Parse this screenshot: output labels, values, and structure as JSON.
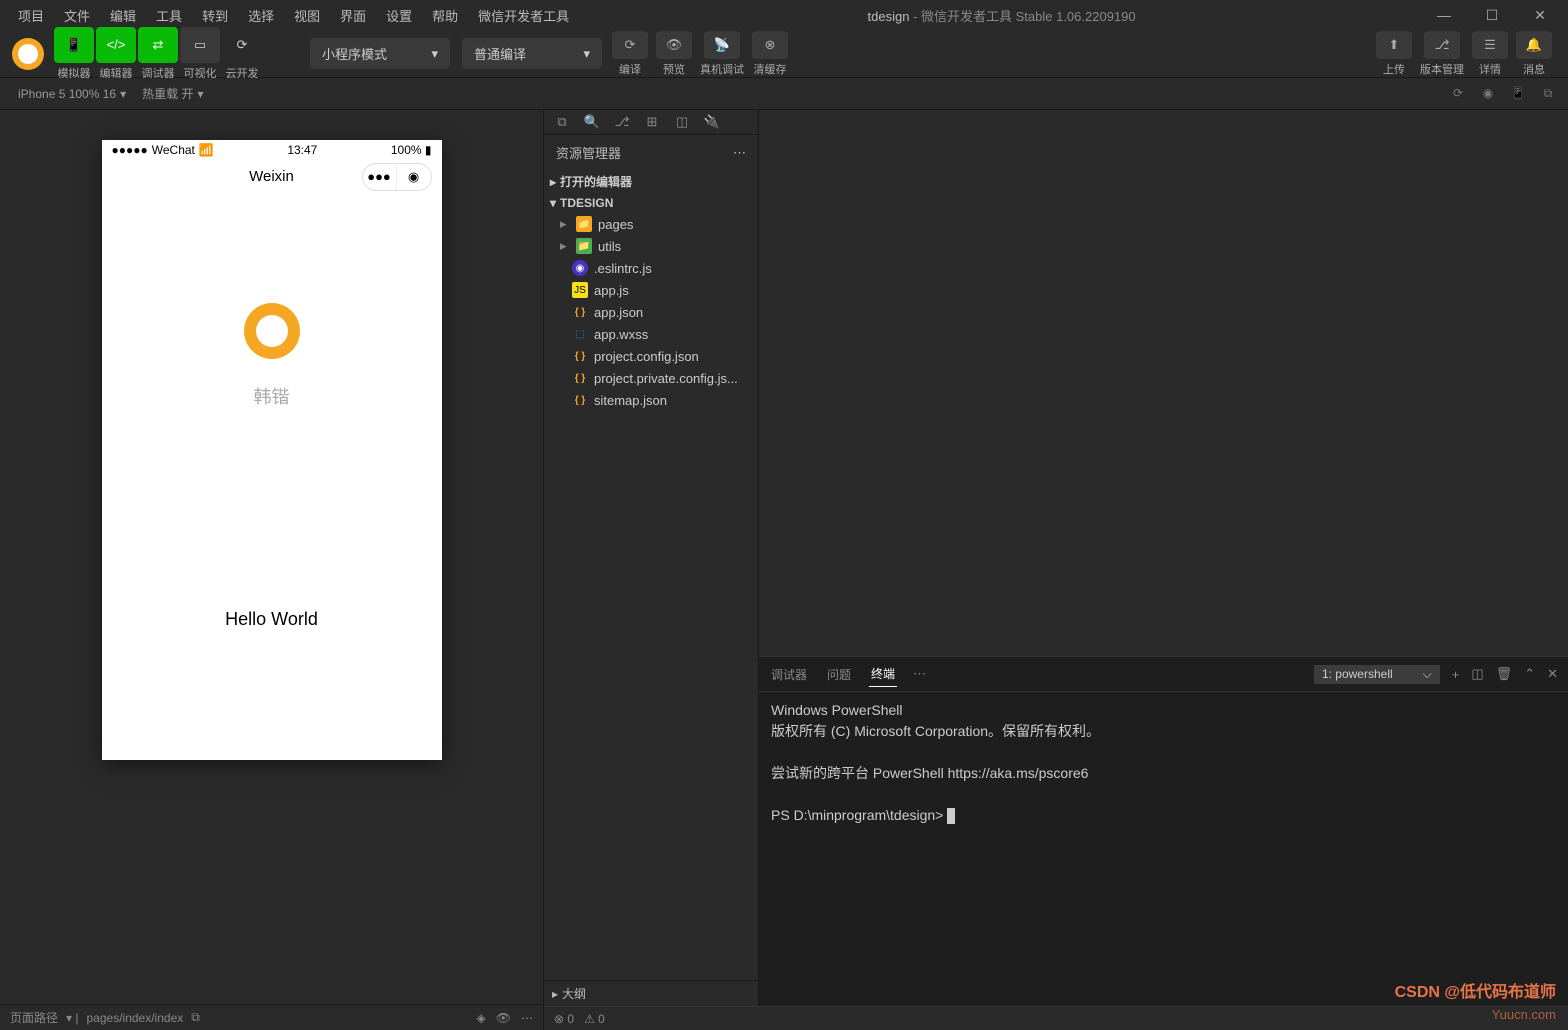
{
  "menubar": [
    "项目",
    "文件",
    "编辑",
    "工具",
    "转到",
    "选择",
    "视图",
    "界面",
    "设置",
    "帮助",
    "微信开发者工具"
  ],
  "title": {
    "proj": "tdesign",
    "rest": " - 微信开发者工具 Stable 1.06.2209190"
  },
  "toolbar": {
    "modes": [
      "模拟器",
      "编辑器",
      "调试器",
      "可视化",
      "云开发"
    ],
    "mode_dropdown": "小程序模式",
    "compile_dropdown": "普通编译",
    "actions": [
      "编译",
      "预览",
      "真机调试",
      "清缓存"
    ],
    "right": [
      "上传",
      "版本管理",
      "详情",
      "消息"
    ]
  },
  "simbar": {
    "device": "iPhone 5 100% 16",
    "reload": "热重载 开"
  },
  "phone": {
    "wechat": "WeChat",
    "time": "13:47",
    "battery": "100%",
    "nav_title": "Weixin",
    "username": "韩锴",
    "hello": "Hello World"
  },
  "explorer": {
    "header": "资源管理器",
    "section_open": "打开的编辑器",
    "section_proj": "TDESIGN",
    "files": [
      {
        "name": "pages",
        "type": "folder",
        "cls": "fi-folder"
      },
      {
        "name": "utils",
        "type": "folder",
        "cls": "fi-folder-g"
      },
      {
        "name": ".eslintrc.js",
        "type": "file",
        "cls": "fi-eslint",
        "ico": "◉"
      },
      {
        "name": "app.js",
        "type": "file",
        "cls": "fi-js",
        "ico": "JS"
      },
      {
        "name": "app.json",
        "type": "file",
        "cls": "fi-json",
        "ico": "{ }"
      },
      {
        "name": "app.wxss",
        "type": "file",
        "cls": "fi-wxss",
        "ico": "⬚"
      },
      {
        "name": "project.config.json",
        "type": "file",
        "cls": "fi-json",
        "ico": "{ }"
      },
      {
        "name": "project.private.config.js...",
        "type": "file",
        "cls": "fi-json",
        "ico": "{ }"
      },
      {
        "name": "sitemap.json",
        "type": "file",
        "cls": "fi-json",
        "ico": "{ }"
      }
    ],
    "outline": "大纲"
  },
  "terminal": {
    "tabs": [
      "调试器",
      "问题",
      "终端"
    ],
    "active_tab": "终端",
    "dropdown": "1: powershell",
    "lines": [
      "Windows PowerShell",
      "版权所有 (C) Microsoft Corporation。保留所有权利。",
      "",
      "尝试新的跨平台 PowerShell https://aka.ms/pscore6",
      ""
    ],
    "prompt": "PS D:\\minprogram\\tdesign>"
  },
  "statusbar": {
    "path_label": "页面路径",
    "path": "pages/index/index"
  },
  "editor_status": {
    "errors": "⊗ 0",
    "warnings": "⚠ 0"
  },
  "watermark": "CSDN @低代码布道师",
  "watermark2": "Yuucn.com"
}
